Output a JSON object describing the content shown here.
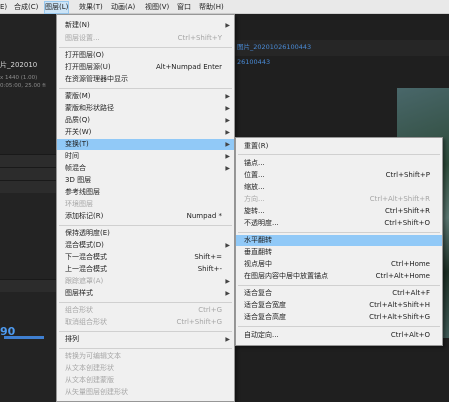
{
  "menubar": {
    "items": [
      {
        "label": "E)"
      },
      {
        "label": "合成(C)"
      },
      {
        "label": "图层(L)"
      },
      {
        "label": "效果(T)"
      },
      {
        "label": "动画(A)"
      },
      {
        "label": "视图(V)"
      },
      {
        "label": "窗口"
      },
      {
        "label": "帮助(H)"
      }
    ]
  },
  "background": {
    "tab_text_1": "图片_20201026100443",
    "tab_text_2": "26100443",
    "left_title": "片_202010",
    "left_sub_1": "x 1440 (1.00)",
    "left_sub_2": "0:05:00, 25.00 fi",
    "left_num": "90"
  },
  "layer_menu": {
    "items": [
      {
        "label": "新建(N)",
        "shortcut": "",
        "submenu": true,
        "disabled": false
      },
      {
        "label": "图层设置...",
        "shortcut": "Ctrl+Shift+Y",
        "submenu": false,
        "disabled": true
      },
      {
        "label": "打开图层(O)",
        "shortcut": "",
        "submenu": false,
        "disabled": false
      },
      {
        "label": "打开图层源(U)",
        "shortcut": "Alt+Numpad Enter",
        "submenu": false,
        "disabled": false
      },
      {
        "label": "在资源管理器中显示",
        "shortcut": "",
        "submenu": false,
        "disabled": false
      },
      {
        "label": "蒙版(M)",
        "shortcut": "",
        "submenu": true,
        "disabled": false
      },
      {
        "label": "蒙版和形状路径",
        "shortcut": "",
        "submenu": true,
        "disabled": false
      },
      {
        "label": "品质(Q)",
        "shortcut": "",
        "submenu": true,
        "disabled": false
      },
      {
        "label": "开关(W)",
        "shortcut": "",
        "submenu": true,
        "disabled": false
      },
      {
        "label": "变换(T)",
        "shortcut": "",
        "submenu": true,
        "disabled": false
      },
      {
        "label": "时间",
        "shortcut": "",
        "submenu": true,
        "disabled": false
      },
      {
        "label": "帧混合",
        "shortcut": "",
        "submenu": true,
        "disabled": false
      },
      {
        "label": "3D 图层",
        "shortcut": "",
        "submenu": false,
        "disabled": false
      },
      {
        "label": "参考线图层",
        "shortcut": "",
        "submenu": false,
        "disabled": false
      },
      {
        "label": "环境图层",
        "shortcut": "",
        "submenu": false,
        "disabled": true
      },
      {
        "label": "添加标记(R)",
        "shortcut": "Numpad *",
        "submenu": false,
        "disabled": false
      },
      {
        "label": "保持透明度(E)",
        "shortcut": "",
        "submenu": false,
        "disabled": false
      },
      {
        "label": "混合模式(D)",
        "shortcut": "",
        "submenu": true,
        "disabled": false
      },
      {
        "label": "下一混合模式",
        "shortcut": "Shift+=",
        "submenu": false,
        "disabled": false
      },
      {
        "label": "上一混合模式",
        "shortcut": "Shift+-",
        "submenu": false,
        "disabled": false
      },
      {
        "label": "跟踪遮罩(A)",
        "shortcut": "",
        "submenu": true,
        "disabled": true
      },
      {
        "label": "图层样式",
        "shortcut": "",
        "submenu": true,
        "disabled": false
      },
      {
        "label": "组合形状",
        "shortcut": "Ctrl+G",
        "submenu": false,
        "disabled": true
      },
      {
        "label": "取消组合形状",
        "shortcut": "Ctrl+Shift+G",
        "submenu": false,
        "disabled": true
      },
      {
        "label": "排列",
        "shortcut": "",
        "submenu": true,
        "disabled": false
      },
      {
        "label": "转换为可编辑文本",
        "shortcut": "",
        "submenu": false,
        "disabled": true
      },
      {
        "label": "从文本创建形状",
        "shortcut": "",
        "submenu": false,
        "disabled": true
      },
      {
        "label": "从文本创建蒙版",
        "shortcut": "",
        "submenu": false,
        "disabled": true
      },
      {
        "label": "从矢量图层创建形状",
        "shortcut": "",
        "submenu": false,
        "disabled": true
      }
    ]
  },
  "transform_submenu": {
    "items": [
      {
        "label": "重置(R)",
        "shortcut": "",
        "disabled": false
      },
      {
        "label": "锚点...",
        "shortcut": "",
        "disabled": false
      },
      {
        "label": "位置...",
        "shortcut": "Ctrl+Shift+P",
        "disabled": false
      },
      {
        "label": "缩放...",
        "shortcut": "",
        "disabled": false
      },
      {
        "label": "方向...",
        "shortcut": "Ctrl+Alt+Shift+R",
        "disabled": true
      },
      {
        "label": "旋转...",
        "shortcut": "Ctrl+Shift+R",
        "disabled": false
      },
      {
        "label": "不透明度...",
        "shortcut": "Ctrl+Shift+O",
        "disabled": false
      },
      {
        "label": "水平翻转",
        "shortcut": "",
        "disabled": false
      },
      {
        "label": "垂直翻转",
        "shortcut": "",
        "disabled": false
      },
      {
        "label": "视点居中",
        "shortcut": "Ctrl+Home",
        "disabled": false
      },
      {
        "label": "在图层内容中居中放置锚点",
        "shortcut": "Ctrl+Alt+Home",
        "disabled": false
      },
      {
        "label": "适合复合",
        "shortcut": "Ctrl+Alt+F",
        "disabled": false
      },
      {
        "label": "适合复合宽度",
        "shortcut": "Ctrl+Alt+Shift+H",
        "disabled": false
      },
      {
        "label": "适合复合高度",
        "shortcut": "Ctrl+Alt+Shift+G",
        "disabled": false
      },
      {
        "label": "自动定向...",
        "shortcut": "Ctrl+Alt+O",
        "disabled": false
      }
    ]
  }
}
